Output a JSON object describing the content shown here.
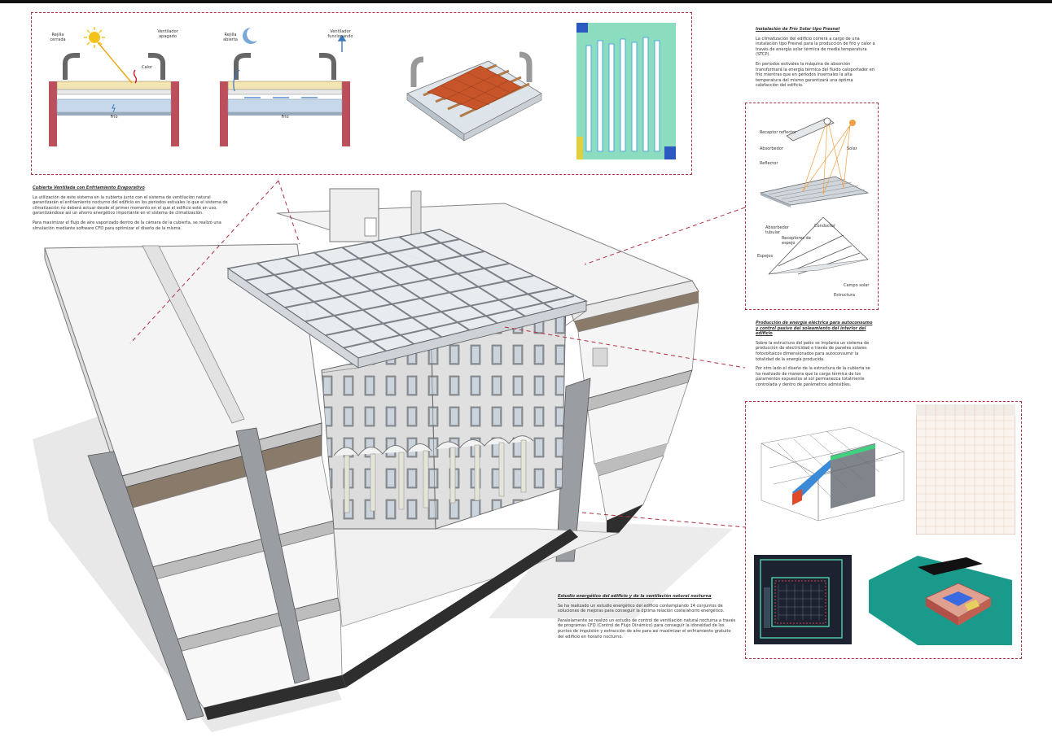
{
  "cubierta": {
    "title": "Cubierta Ventilada con Enfriamiento Evaporativo",
    "p1": "La utilización de este sistema en la cubierta junto con el sistema de ventilación natural garantizarán el enfriamiento nocturno del edificio en los periodos estivales lo que el sistema de climatización no deberá actuar desde el primer momento en el que el edificio esté en uso, garantizándose así un ahorro energético importante en el sistema de climatización.",
    "p2": "Para maximizar el flujo de aire vaporizado dentro de la cámara de la cubierta, se realizó una simulación mediante software CFD para optimizar el diseño de la misma."
  },
  "diagram1": {
    "label_left": "Rejilla cerrada",
    "label_right": "Ventilador apagado",
    "label_heat": "Calor",
    "label_bottom": "Frío"
  },
  "diagram2": {
    "label_left": "Rejilla abierta",
    "label_right": "Ventilador funcionando",
    "label_bottom": "Frío"
  },
  "frio_solar": {
    "title": "Instalación de Frío Solar tipo Fresnel",
    "p1": "La climatización del edificio correrá a cargo de una instalación tipo Fresnel para la producción de frío y calor a través de energía solar térmica de media temperatura (STCP).",
    "p2": "En periodos estivales la máquina de absorción transformará la energía térmica del fluido caloportador en frío mientras que en periodos invernales la alta temperatura del mismo garantizará una óptima calefacción del edificio."
  },
  "fresnel_labels": {
    "receptor": "Receptor reflector",
    "absorbedor": "Absorbedor",
    "reflector": "Reflector",
    "solar": "Solar",
    "receptor_tubo": "Absorbedor tubular",
    "conductor": "Conductor",
    "campo": "Campo solar",
    "espejos": "Espejos",
    "estructura": "Estructura",
    "receptores": "Receptores de espejo"
  },
  "produccion": {
    "title": "Producción de energía eléctrica para autoconsumo y control pasivo del soleamiento del interior del edificio",
    "p1": "Sobre la estructura del patio se implanta un sistema de producción de electricidad a través de paneles solares fotovoltaicos dimensionados para autoconsumir la totalidad de la energía producida.",
    "p2": "Por otro lado el diseño de la estructura de la cubierta se ha realizado de manera que la carga térmica de los paramentos expuestos al sol permanezca totalmente controlada y dentro de parámetros admisibles."
  },
  "estudio": {
    "title": "Estudio energético del edificio y de la ventilación natural nocturna",
    "p1": "Se ha realizado un estudio energético del edificio contemplando 14 conjuntos de soluciones de mejoras para conseguir la óptima relación coste/ahorro energético.",
    "p2": "Paralelamente se realizó un estudio de control de ventilación natural nocturna a través de programas CFD (Control de Flujo Dinámico) para conseguir la idoneidad de los puntos de impulsión y extracción de aire para así maximizar el enfriamiento gratuito del edificio en horario nocturno."
  },
  "colors": {
    "dashed_frame": "#b03040",
    "roof_tiles": "#c8552a",
    "cfd_green": "#7bd8a0",
    "cfd_blue": "#4aa8e0",
    "teal_ground": "#1a9a8a",
    "building_gray": "#cfd0d2"
  },
  "icons": [
    "sun-icon",
    "moon-icon",
    "arrow-up-icon",
    "heat-wave-icon"
  ]
}
